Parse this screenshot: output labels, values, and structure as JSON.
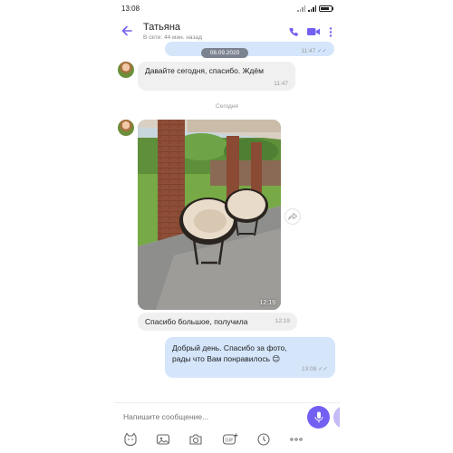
{
  "status_bar": {
    "time": "13:08"
  },
  "header": {
    "back_icon": "arrow-left-icon",
    "contact_name": "Татьяна",
    "contact_status": "В сети: 44 мин. назад",
    "icons": [
      "phone-icon",
      "video-icon",
      "more-vertical-icon"
    ]
  },
  "chat": {
    "partial_out_time": "11:47",
    "date_chip": "08.09.2020",
    "messages": [
      {
        "direction": "in",
        "text": "Давайте сегодня, спасибо. Ждём",
        "time": "11:47"
      },
      {
        "direction": "in",
        "type": "photo",
        "time": "12:19"
      },
      {
        "direction": "in",
        "text": "Спасибо большое, получила",
        "time": "12:19"
      },
      {
        "direction": "out",
        "text_line1": "Добрый день. Спасибо за фото,",
        "text_line2": "рады что Вам понравилось 😊",
        "time": "13:08"
      }
    ],
    "day_separator": "Сегодня"
  },
  "composer": {
    "placeholder": "Напишите сообщение...",
    "toolbar_icons": [
      "sticker-icon",
      "gallery-icon",
      "camera-icon",
      "gif-icon",
      "clock-icon",
      "more-dots-icon"
    ],
    "mic_icon": "microphone-icon"
  },
  "colors": {
    "accent": "#7360f2",
    "outgoing_bubble": "#d5e6fb",
    "incoming_bubble": "#f0f0f0"
  }
}
